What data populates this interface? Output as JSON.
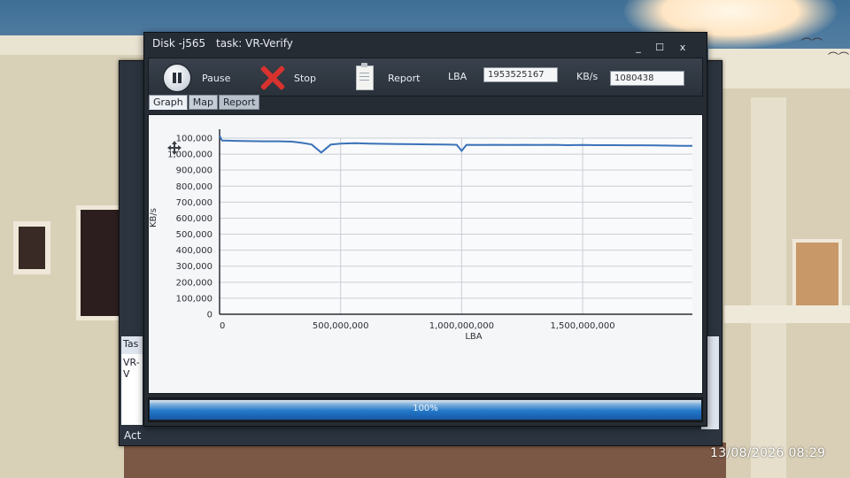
{
  "window": {
    "disk_name": "Disk -j565",
    "task": "task: VR-Verify",
    "min_glyph": "_",
    "max_glyph": "☐",
    "close_glyph": "x"
  },
  "toolbar": {
    "pause_label": "Pause",
    "stop_label": "Stop",
    "report_label": "Report",
    "lba_label": "LBA",
    "lba_value": "1953525167",
    "kbs_label": "KB/s",
    "kbs_value": "1080438"
  },
  "tabs": [
    {
      "label": "Graph",
      "active": true
    },
    {
      "label": "Map",
      "active": false
    },
    {
      "label": "Report",
      "active": false
    }
  ],
  "progress": {
    "value": 1.0,
    "text": "100%"
  },
  "background_window": {
    "task_header": "Tas",
    "task_row": "VR-V",
    "footer": "Act"
  },
  "timestamp": "13/08/2026 08:29",
  "colors": {
    "line": "#3a72b8",
    "accent": "#2478c9",
    "stop": "#d9322e"
  },
  "icons": [
    "pause-icon",
    "stop-icon",
    "report-icon",
    "move-icon"
  ],
  "chart_data": {
    "type": "line",
    "xlabel": "LBA",
    "ylabel": "KB/s",
    "xlim": [
      0,
      1953525167
    ],
    "ylim": [
      0,
      1100000
    ],
    "xticks": [
      0,
      500000000,
      1000000000,
      1500000000
    ],
    "xtick_labels": [
      "0",
      "500,000,000",
      "1,000,000,000",
      "1,500,000,000"
    ],
    "yticks": [
      0,
      100000,
      200000,
      300000,
      400000,
      500000,
      600000,
      700000,
      800000,
      900000,
      1000000,
      1100000
    ],
    "ytick_labels": [
      "0",
      "100,000",
      "200,000",
      "300,000",
      "400,000",
      "500,000",
      "600,000",
      "700,000",
      "800,000",
      "900,000",
      "1,000,000",
      "100,000"
    ],
    "grid": true,
    "series": [
      {
        "x": [
          0,
          10000000,
          60000000,
          120000000,
          180000000,
          240000000,
          300000000,
          340000000,
          380000000,
          420000000,
          460000000,
          500000000,
          560000000,
          620000000,
          680000000,
          740000000,
          800000000,
          860000000,
          920000000,
          980000000,
          1000000000,
          1020000000,
          1080000000,
          1140000000,
          1200000000,
          1260000000,
          1320000000,
          1380000000,
          1440000000,
          1500000000,
          1560000000,
          1620000000,
          1680000000,
          1740000000,
          1800000000,
          1860000000,
          1920000000,
          1953525167
        ],
        "y": [
          1115000,
          1085000,
          1083000,
          1081000,
          1080000,
          1080000,
          1078000,
          1070000,
          1060000,
          1010000,
          1060000,
          1065000,
          1068000,
          1066000,
          1064000,
          1063000,
          1062000,
          1061000,
          1060000,
          1058000,
          1020000,
          1058000,
          1057000,
          1058000,
          1057000,
          1058000,
          1057000,
          1058000,
          1056000,
          1057000,
          1056000,
          1056000,
          1055000,
          1055000,
          1054000,
          1053000,
          1052000,
          1052000
        ]
      }
    ]
  }
}
